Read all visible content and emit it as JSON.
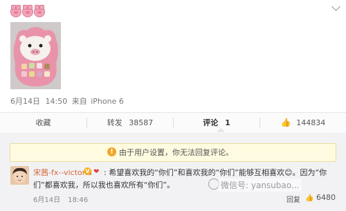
{
  "post": {
    "date": "6月14日",
    "time": "14:50",
    "source_prefix": "来自",
    "source_device": "iPhone 6"
  },
  "actions": {
    "collect_label": "收藏",
    "repost_label": "转发",
    "repost_count": "38587",
    "comment_label": "评论",
    "comment_count": "1",
    "like_count": "144834"
  },
  "notice": {
    "text": "由于用户设置，你无法回复评论。"
  },
  "comment": {
    "user": "宋茜-fx--victoria",
    "text": ": 希望喜欢我的“你们”和喜欢我的“你们”能够互相喜欢😊。因为“你们”都喜欢我，所以我也喜欢所有“你们”。",
    "date": "6月14日",
    "time": "18:46",
    "reply_label": "回复",
    "like_count": "6480"
  },
  "watermark": {
    "text": "微信号: yansubao..."
  },
  "colors": {
    "pink": "#f3a6b8",
    "username": "#d46a3a",
    "notice_bg": "#fffbe0",
    "warning": "#f3a42b"
  }
}
